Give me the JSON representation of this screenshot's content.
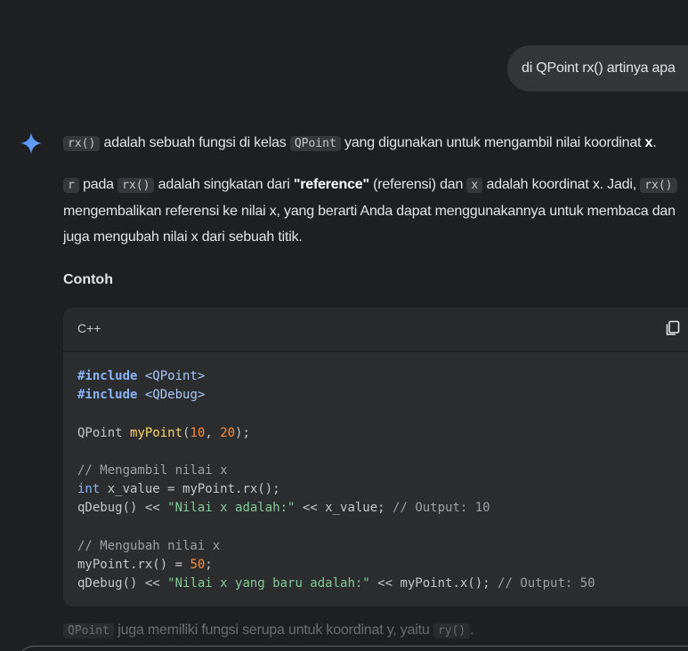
{
  "user_message": "di QPoint rx() artinya apa",
  "response": {
    "p1": {
      "code1": "rx()",
      "t1": " adalah sebuah fungsi di kelas ",
      "code2": "QPoint",
      "t2": " yang digunakan untuk mengambil nilai koordinat ",
      "bold": "x",
      "t3": "."
    },
    "p2": {
      "code1": "r",
      "t1": " pada ",
      "code2": "rx()",
      "t2": " adalah singkatan dari ",
      "bold": "\"reference\"",
      "t3": " (referensi) dan ",
      "code3": "x",
      "t4": " adalah koordinat x. Jadi, ",
      "code4": "rx()",
      "t5": " mengembalikan referensi ke nilai x, yang berarti Anda dapat menggunakannya untuk membaca dan juga mengubah nilai x dari sebuah titik."
    },
    "heading": "Contoh"
  },
  "code_block": {
    "language": "C++",
    "copy_icon": "copy-icon",
    "lines": {
      "l1": {
        "kw": "#include",
        "inc": " <QPoint>"
      },
      "l2": {
        "kw": "#include",
        "inc": " <QDebug>"
      },
      "l4": {
        "a": "QPoint ",
        "fn": "myPoint",
        "b": "(",
        "n1": "10",
        "c": ", ",
        "n2": "20",
        "d": ");"
      },
      "l6": {
        "cm": "// Mengambil nilai x"
      },
      "l7": {
        "ty": "int",
        "rest": " x_value = myPoint.rx();"
      },
      "l8": {
        "a": "qDebug() << ",
        "str": "\"Nilai x adalah:\"",
        "b": " << x_value; ",
        "cm": "// Output: 10"
      },
      "l10": {
        "cm": "// Mengubah nilai x"
      },
      "l11": {
        "a": "myPoint.rx() = ",
        "num": "50",
        "b": ";"
      },
      "l12": {
        "a": "qDebug() << ",
        "str": "\"Nilai x yang baru adalah:\"",
        "b": " << myPoint.x(); ",
        "cm": "// Output: 50"
      }
    }
  },
  "footer": {
    "code1": "QPoint",
    "t1": " juga memiliki fungsi serupa untuk koordinat y, yaitu ",
    "code2": "ry()",
    "t2": "."
  },
  "colors": {
    "background": "#1e1f21",
    "bubble": "#333538",
    "code_bg": "#2b2c2e",
    "keyword": "#8ab4f8",
    "function": "#fdd663",
    "number": "#ff8c3a",
    "string": "#81c995",
    "comment": "#9aa0a6"
  }
}
